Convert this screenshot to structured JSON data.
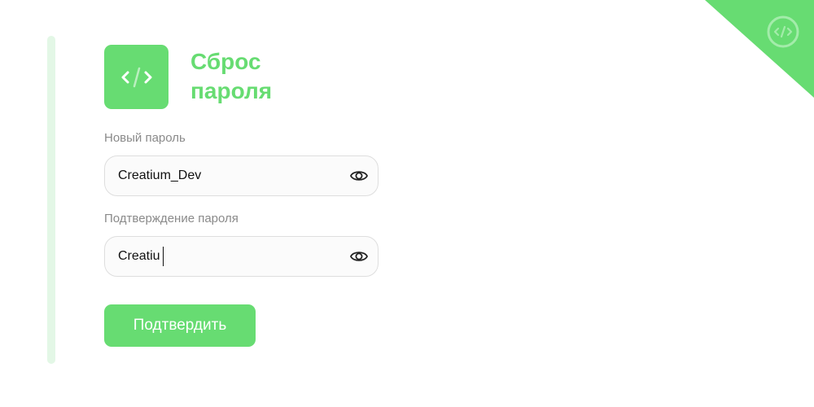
{
  "brand": {
    "logo_icon": "code-icon",
    "accent_color": "#67dc72",
    "accent_light": "#e3f7e6",
    "corner_icon": "code-icon"
  },
  "header": {
    "title_line1": "Сброс",
    "title_line2": "пароля"
  },
  "form": {
    "new_password": {
      "label": "Новый пароль",
      "value": "Creatium_Dev",
      "toggle_icon": "eye-icon"
    },
    "confirm_password": {
      "label": "Подтверждение пароля",
      "value": "Creatiu",
      "toggle_icon": "eye-icon"
    },
    "submit_label": "Подтвердить"
  }
}
